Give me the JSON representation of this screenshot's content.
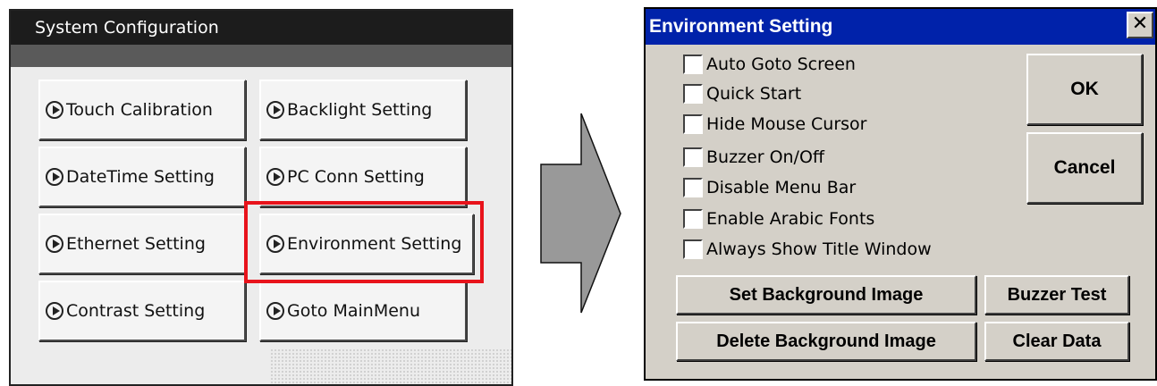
{
  "system_config": {
    "title": "System Configuration",
    "buttons": [
      {
        "label": "Touch Calibration",
        "icon": "play-circle-icon"
      },
      {
        "label": "Backlight Setting",
        "icon": "play-circle-icon"
      },
      {
        "label": "DateTime Setting",
        "icon": "play-circle-icon"
      },
      {
        "label": "PC Conn Setting",
        "icon": "play-circle-icon"
      },
      {
        "label": "Ethernet Setting",
        "icon": "play-circle-icon"
      },
      {
        "label": "Environment Setting",
        "icon": "play-circle-icon"
      },
      {
        "label": "Contrast Setting",
        "icon": "play-circle-icon"
      },
      {
        "label": "Goto MainMenu",
        "icon": "play-circle-icon"
      }
    ],
    "highlighted": "Environment Setting"
  },
  "env_dialog": {
    "title": "Environment Setting",
    "close_label": "✕",
    "options": [
      {
        "label": "Auto Goto Screen",
        "checked": false
      },
      {
        "label": "Quick Start",
        "checked": false
      },
      {
        "label": "Hide Mouse Cursor",
        "checked": false
      },
      {
        "label": "Buzzer On/Off",
        "checked": false
      },
      {
        "label": "Disable Menu Bar",
        "checked": false
      },
      {
        "label": "Enable Arabic Fonts",
        "checked": false
      },
      {
        "label": "Always Show Title Window",
        "checked": false
      }
    ],
    "ok_label": "OK",
    "cancel_label": "Cancel",
    "set_bg_label": "Set Background Image",
    "buzzer_test_label": "Buzzer Test",
    "delete_bg_label": "Delete Background Image",
    "clear_data_label": "Clear Data"
  },
  "colors": {
    "dialog_title_bar": "#0022aa",
    "highlight": "#e8131b",
    "panel_title_bar": "#1c1c1c"
  }
}
